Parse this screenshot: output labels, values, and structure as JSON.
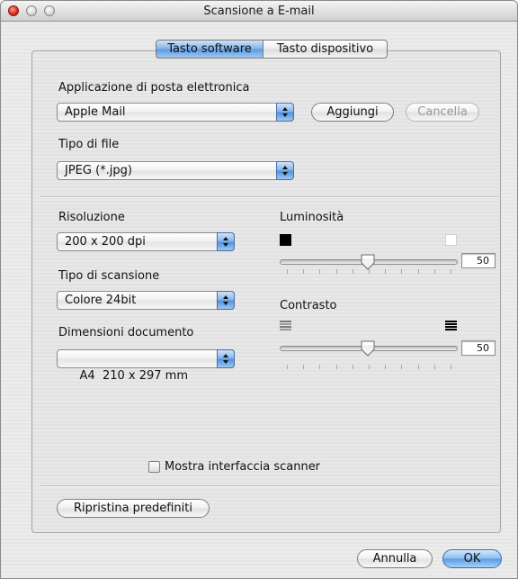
{
  "window": {
    "title": "Scansione a E-mail"
  },
  "tabs": [
    {
      "label": "Tasto software",
      "active": true
    },
    {
      "label": "Tasto dispositivo",
      "active": false
    }
  ],
  "email": {
    "label": "Applicazione di posta elettronica",
    "selected": "Apple Mail",
    "add_label": "Aggiungi",
    "remove_label": "Cancella"
  },
  "file_type": {
    "label": "Tipo di file",
    "selected": "JPEG (*.jpg)"
  },
  "resolution": {
    "label": "Risoluzione",
    "selected": "200 x 200 dpi"
  },
  "scan_type": {
    "label": "Tipo di scansione",
    "selected": "Colore 24bit"
  },
  "doc_size": {
    "label": "Dimensioni documento",
    "selected": "A4  210 x 297 mm"
  },
  "brightness": {
    "label": "Luminosità",
    "value": "50",
    "level": 0.5
  },
  "contrast": {
    "label": "Contrasto",
    "value": "50",
    "level": 0.5
  },
  "show_scanner_ui": {
    "label": "Mostra interfaccia scanner",
    "checked": false
  },
  "restore_defaults_label": "Ripristina predefiniti",
  "footer": {
    "cancel_label": "Annulla",
    "ok_label": "OK"
  },
  "icons": {
    "close": "close-button-icon",
    "minimize": "minimize-button-icon",
    "zoom": "zoom-button-icon",
    "popup_arrows": "up-down-arrows-icon",
    "slider_thumb": "slider-thumb-icon"
  },
  "colors": {
    "accent": "#5d99e0",
    "close": "#d8261b"
  }
}
